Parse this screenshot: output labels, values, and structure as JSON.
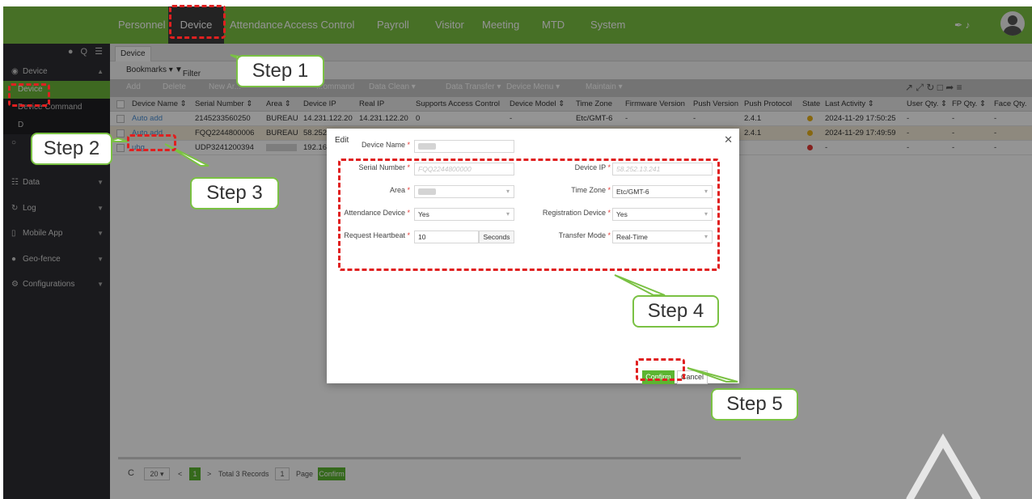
{
  "topnav": {
    "items": [
      "Personnel",
      "Device",
      "Attendance",
      "Access Control",
      "Payroll",
      "Visitor",
      "Meeting",
      "MTD",
      "System"
    ],
    "active": "Device",
    "tools": "✒ ♪"
  },
  "sidebar": {
    "tools": "● Q ☰",
    "section": "Device",
    "items": [
      "Device",
      "Device Command",
      "Data",
      "Log",
      "Mobile App",
      "Geo-fence",
      "Configurations"
    ],
    "sub_hidden_label": "D"
  },
  "main": {
    "tab": "Device",
    "bookmarks": "Bookmarks ▾",
    "filter": "Filter",
    "actions": [
      "Add",
      "Delete",
      "New Ar...",
      "...ommand",
      "Data Clean ▾",
      "Data Transfer ▾",
      "Device Menu ▾",
      "Maintain ▾"
    ],
    "right_tools": "↗  ⤢  ↻  □  ➦  ≡",
    "columns": [
      "Device Name ⇕",
      "Serial Number ⇕",
      "Area ⇕",
      "Device IP",
      "Real IP",
      "Supports Access Control",
      "Device Model ⇕",
      "Time Zone",
      "Firmware Version",
      "Push Version",
      "Push Protocol",
      "State",
      "Last Activity ⇕",
      "User Qty. ⇕",
      "FP Qty. ⇕",
      "Face Qty."
    ],
    "rows": [
      {
        "name": "Auto add",
        "serial": "2145233560250",
        "area": "BUREAU",
        "ip": "14.231.122.20",
        "real_ip": "14.231.122.20",
        "sac": "0",
        "model": "-",
        "tz": "Etc/GMT-6",
        "fw": "-",
        "pv": "-",
        "pp": "2.4.1",
        "state": "warn",
        "last": "2024-11-29 17:50:25",
        "u": "-",
        "fp": "-",
        "face": "-"
      },
      {
        "name": "Auto add",
        "serial": "FQQ2244800006",
        "area": "BUREAU",
        "ip": "58.252",
        "real_ip": "",
        "sac": "",
        "model": "",
        "tz": "",
        "fw": "",
        "pv": "",
        "pp": "2.4.1",
        "state": "warn",
        "last": "2024-11-29 17:49:59",
        "u": "-",
        "fp": "-",
        "face": "-"
      },
      {
        "name": "uhg",
        "serial": "UDP3241200394",
        "area": "",
        "ip": "192.16",
        "real_ip": "",
        "sac": "",
        "model": "",
        "tz": "",
        "fw": "",
        "pv": "",
        "pp": "",
        "state": "err",
        "last": "-",
        "u": "-",
        "fp": "-",
        "face": "-"
      }
    ],
    "pager": {
      "refresh": "C",
      "size": "20 ▾",
      "prev": "<",
      "page": "1",
      "next": ">",
      "total": "Total 3 Records",
      "goto": "1",
      "page_label": "Page",
      "confirm": "Confirm"
    }
  },
  "dialog": {
    "title": "Edit",
    "close": "✕",
    "fields": {
      "device_name": {
        "label": "Device Name",
        "value": ""
      },
      "serial_number": {
        "label": "Serial Number",
        "value": "FQQ2244800000"
      },
      "device_ip": {
        "label": "Device IP",
        "value": "58.252.13.241"
      },
      "area": {
        "label": "Area",
        "value": ""
      },
      "time_zone": {
        "label": "Time Zone",
        "value": "Etc/GMT-6"
      },
      "attendance_device": {
        "label": "Attendance Device",
        "value": "Yes"
      },
      "registration_device": {
        "label": "Registration Device",
        "value": "Yes"
      },
      "request_heartbeat": {
        "label": "Request Heartbeat",
        "value": "10",
        "suffix": "Seconds"
      },
      "transfer_mode": {
        "label": "Transfer Mode",
        "value": "Real-Time"
      }
    },
    "required_mark": "*",
    "dropdown_glyph": "▾",
    "confirm": "Confirm",
    "cancel": "Cancel"
  },
  "annotations": {
    "steps": [
      "Step 1",
      "Step 2",
      "Step 3",
      "Step 4",
      "Step 5"
    ],
    "colors": {
      "dash": "#e02020",
      "callout_border": "#7ac143",
      "brand_green": "#7ac143"
    }
  }
}
